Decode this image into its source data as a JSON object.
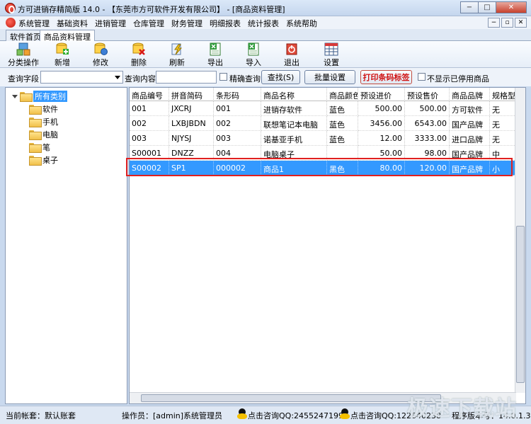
{
  "window": {
    "title": "方可进销存精简版 14.0 - 【东莞市方可软件开发有限公司】 - [商品资料管理]",
    "min_glyph": "−",
    "max_glyph": "□",
    "close_glyph": "✕"
  },
  "menu": {
    "items": [
      "系统管理",
      "基础资料",
      "进销管理",
      "仓库管理",
      "财务管理",
      "明细报表",
      "统计报表",
      "系统帮助"
    ],
    "mdi_min": "−",
    "mdi_restore": "▫",
    "mdi_close": "✕"
  },
  "tabs": [
    "软件首页",
    "商品资料管理"
  ],
  "toolbar": {
    "items": [
      {
        "label": "分类操作",
        "icon": "category-icon"
      },
      {
        "label": "新增",
        "icon": "add-icon"
      },
      {
        "label": "修改",
        "icon": "edit-icon"
      },
      {
        "label": "删除",
        "icon": "delete-icon"
      },
      {
        "label": "刷新",
        "icon": "refresh-icon"
      },
      {
        "label": "导出",
        "icon": "export-excel-icon"
      },
      {
        "label": "导入",
        "icon": "import-excel-icon"
      },
      {
        "label": "退出",
        "icon": "exit-icon"
      },
      {
        "label": "设置",
        "icon": "settings-grid-icon"
      }
    ]
  },
  "search": {
    "field_label": "查询字段",
    "field_value": "",
    "content_label": "查询内容",
    "content_value": "",
    "exact_label": "精确查询",
    "find_button": "查找(S)",
    "batch_button": "批量设置",
    "print_button": "打印条码标签",
    "hide_disabled_label": "不显示已停用商品"
  },
  "tree": {
    "root": "所有类别",
    "children": [
      "软件",
      "手机",
      "电脑",
      "笔",
      "桌子"
    ]
  },
  "grid": {
    "columns": [
      "商品编号",
      "拼音简码",
      "条形码",
      "商品名称",
      "商品颜色",
      "预设进价",
      "预设售价",
      "商品品牌",
      "规格型号"
    ],
    "rows": [
      [
        "001",
        "JXCRJ",
        "001",
        "进销存软件",
        "蓝色",
        "500.00",
        "500.00",
        "方可软件",
        "无"
      ],
      [
        "002",
        "LXBJBDN",
        "002",
        "联想笔记本电脑",
        "蓝色",
        "3456.00",
        "6543.00",
        "国产品牌",
        "无"
      ],
      [
        "003",
        "NJYSJ",
        "003",
        "诺基亚手机",
        "蓝色",
        "12.00",
        "3333.00",
        "进口品牌",
        "无"
      ],
      [
        "S00001",
        "DNZZ",
        "004",
        "电脑桌子",
        "",
        "50.00",
        "98.00",
        "国产品牌",
        "中"
      ],
      [
        "S00002",
        "SP1",
        "000002",
        "商品1",
        "黑色",
        "80.00",
        "120.00",
        "国产品牌",
        "小"
      ]
    ],
    "selected_row": 4
  },
  "status": {
    "account": "当前帐套：默认账套",
    "operator": "操作员：[admin]系统管理员",
    "qq1": "点击咨询QQ:2455247199",
    "qq2": "点击咨询QQ:122640238",
    "version": "程序版本号：14.0.1.3"
  },
  "watermark": "极速下载站"
}
